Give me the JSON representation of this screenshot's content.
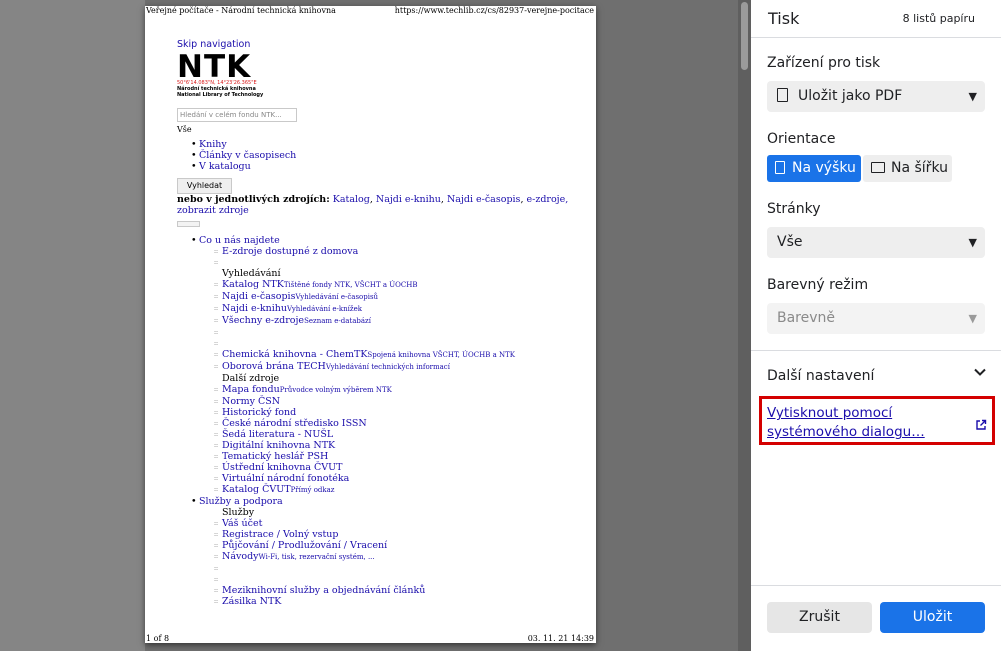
{
  "preview": {
    "header_left": "Veřejné počítače - Národní technická knihovna",
    "header_right": "https://www.techlib.cz/cs/82937-verejne-pocitace",
    "footer_left": "1 of 8",
    "footer_right": "03. 11. 21 14:39",
    "skip_navigation": "Skip navigation",
    "logo": {
      "mark": "NTK",
      "coords": "50°6'14.083\"N, 14°23'26.365\"E",
      "name_cs": "Národní technická knihovna",
      "name_en": "National Library of Technology"
    },
    "search_placeholder": "Hledání v celém fondu NTK...",
    "scope_label": "Vše",
    "scope_options": [
      "Vše",
      "Knihy",
      "Články v časopisech",
      "V katalogu"
    ],
    "search_button": "Vyhledat",
    "sources_prefix": "nebo v jednotlivých zdrojích:",
    "sources_links": [
      "Katalog",
      "Najdi e-knihu",
      "Najdi e-časopis",
      "e-zdroje,",
      "zobrazit zdroje"
    ],
    "nav_section_1": "Co u nás najdete",
    "nav_section_1_items": [
      {
        "text": "E-zdroje dostupné z domova",
        "link": true,
        "note": ""
      },
      {
        "text": "",
        "link": false,
        "note": ""
      },
      {
        "text": "Vyhledávání",
        "link": false,
        "note": ""
      },
      {
        "text": "Katalog NTK",
        "link": true,
        "note": "Tištěné fondy NTK, VŠCHT a ÚOCHB"
      },
      {
        "text": "Najdi e-časopis",
        "link": true,
        "note": "Vyhledávání e-časopisů"
      },
      {
        "text": "Najdi e-knihu",
        "link": true,
        "note": "Vyhledávání e-knížek"
      },
      {
        "text": "Všechny e-zdroje",
        "link": true,
        "note": "Seznam e-databází"
      },
      {
        "text": "",
        "link": false,
        "note": ""
      },
      {
        "text": "",
        "link": false,
        "note": ""
      },
      {
        "text": "Chemická knihovna - ChemTK",
        "link": true,
        "note": "Spojená knihovna VŠCHT, ÚOCHB a NTK"
      },
      {
        "text": "Oborová brána TECH",
        "link": true,
        "note": "Vyhledávání technických informací"
      },
      {
        "text": "Další zdroje",
        "link": false,
        "note": ""
      },
      {
        "text": "Mapa fondu",
        "link": true,
        "note": "Průvodce volným výběrem NTK"
      },
      {
        "text": "Normy ČSN",
        "link": true,
        "note": ""
      },
      {
        "text": "Historický fond",
        "link": true,
        "note": ""
      },
      {
        "text": "České národní středisko ISSN",
        "link": true,
        "note": ""
      },
      {
        "text": "Šedá literatura - NUŠL",
        "link": true,
        "note": ""
      },
      {
        "text": "Digitální knihovna NTK",
        "link": true,
        "note": ""
      },
      {
        "text": "Tematický heslář PSH",
        "link": true,
        "note": ""
      },
      {
        "text": "Ústřední knihovna ČVUT",
        "link": true,
        "note": ""
      },
      {
        "text": "Virtuální národní fonotéka",
        "link": true,
        "note": ""
      },
      {
        "text": "Katalog ČVUT",
        "link": true,
        "note": "Přímý odkaz"
      }
    ],
    "nav_section_2": "Služby a podpora",
    "nav_section_2_items": [
      {
        "text": "Služby",
        "link": false,
        "note": ""
      },
      {
        "text": "Váš účet",
        "link": true,
        "note": ""
      },
      {
        "text": "Registrace / Volný vstup",
        "link": true,
        "note": ""
      },
      {
        "text": "Půjčování / Prodlužování / Vracení",
        "link": true,
        "note": ""
      },
      {
        "text": "Návody",
        "link": true,
        "note": "Wi-Fi, tisk, rezervační systém, ..."
      },
      {
        "text": "",
        "link": false,
        "note": ""
      },
      {
        "text": "",
        "link": false,
        "note": ""
      },
      {
        "text": "Meziknihovní služby a objednávání článků",
        "link": true,
        "note": ""
      },
      {
        "text": "Zásilka NTK",
        "link": true,
        "note": ""
      }
    ]
  },
  "print_panel": {
    "title": "Tisk",
    "sheet_count": "8 listů papíru",
    "destination_label": "Zařízení pro tisk",
    "destination_value": "Uložit jako PDF",
    "orientation_label": "Orientace",
    "orientation_portrait": "Na výšku",
    "orientation_landscape": "Na šířku",
    "pages_label": "Stránky",
    "pages_value": "Vše",
    "color_label": "Barevný režim",
    "color_value": "Barevně",
    "more_settings": "Další nastavení",
    "system_dialog_link": "Vytisknout pomocí systémového dialogu…",
    "cancel": "Zrušit",
    "save": "Uložit"
  },
  "colors": {
    "accent": "#1a73e8",
    "highlight_border": "#d40000",
    "link": "#1a0dab"
  }
}
